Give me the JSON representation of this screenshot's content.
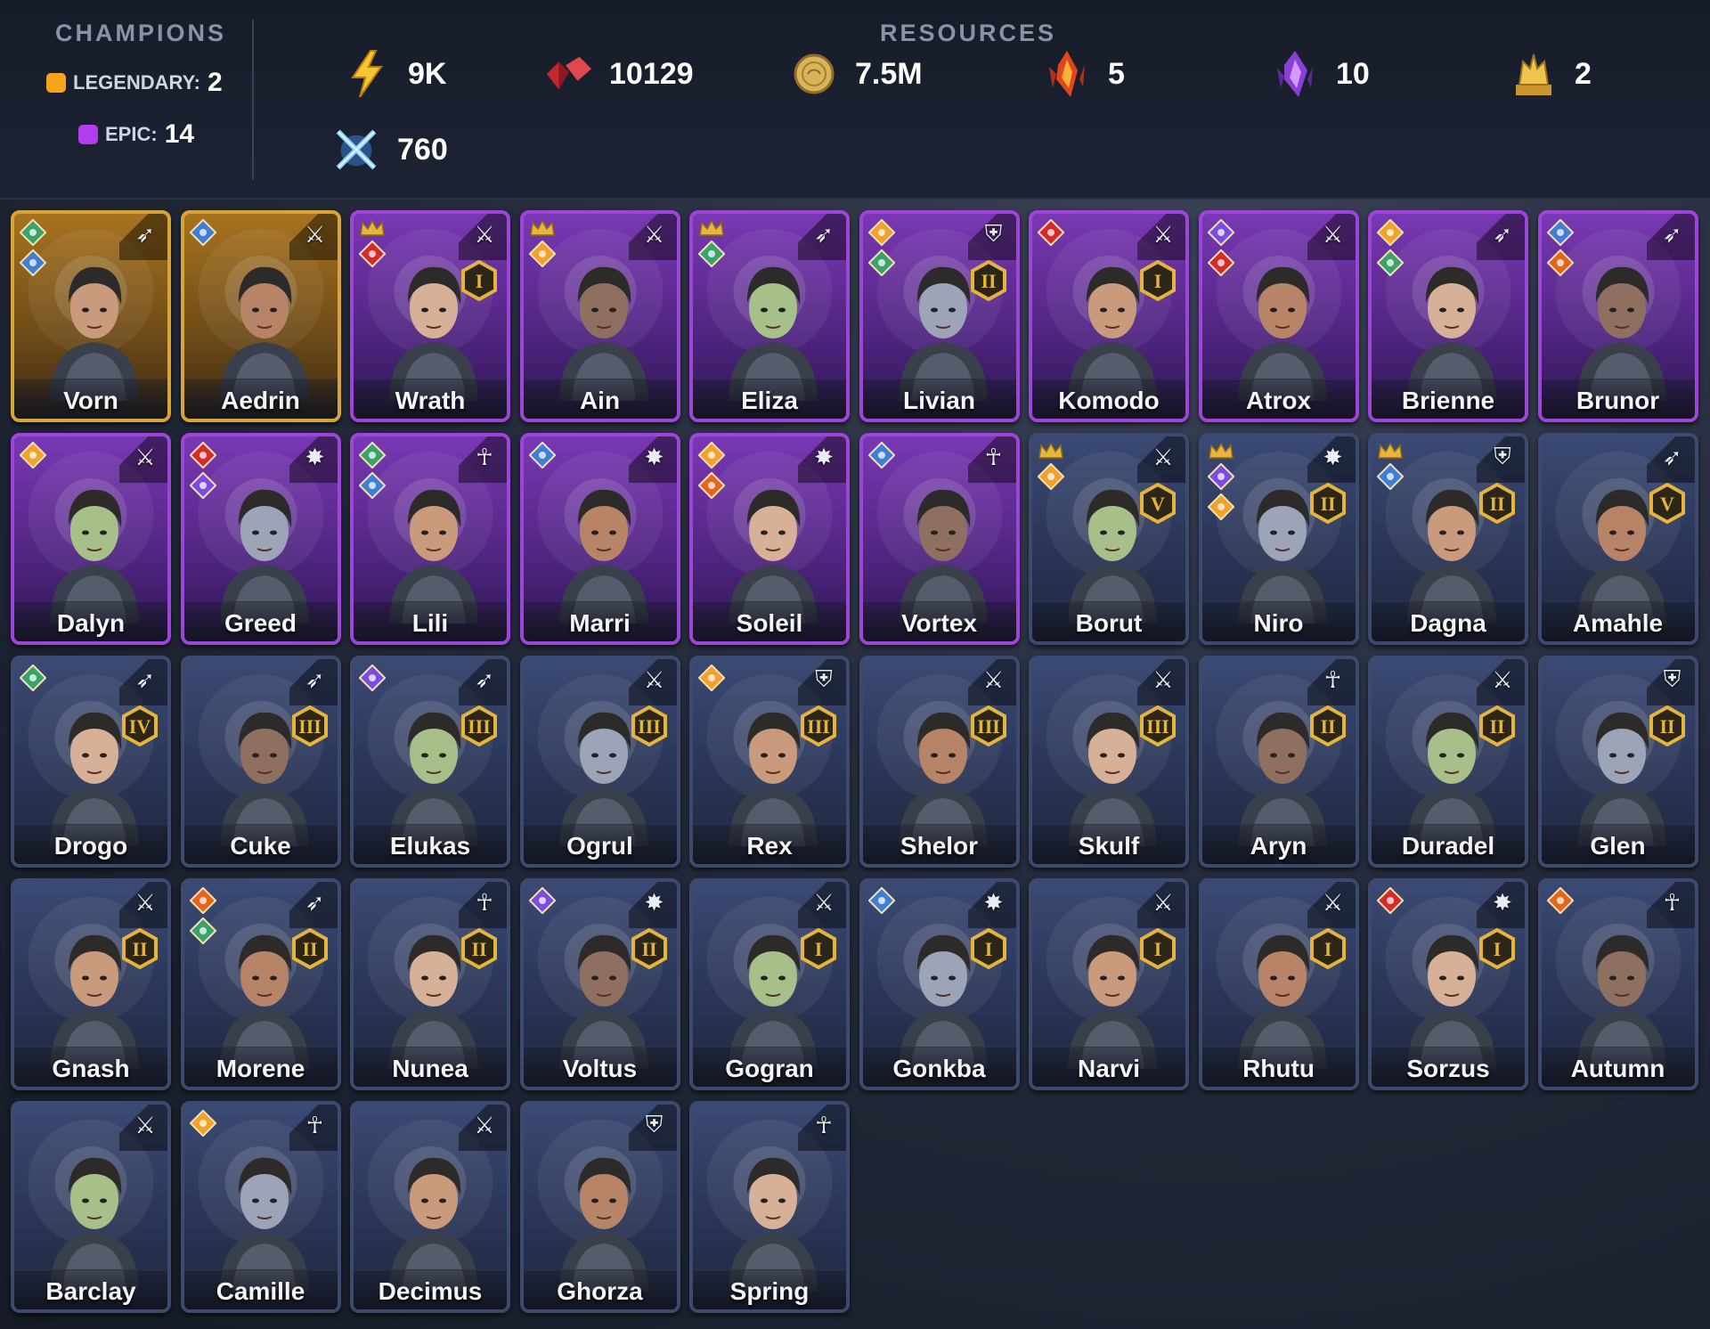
{
  "header": {
    "champions_title": "CHAMPIONS",
    "resources_title": "RESOURCES",
    "legendary": {
      "label": "LEGENDARY:",
      "count": "2",
      "color": "#f4a51c"
    },
    "epic": {
      "label": "EPIC:",
      "count": "14",
      "color": "#b23cf0"
    },
    "resources": [
      {
        "icon": "energy-icon",
        "value": "9K"
      },
      {
        "icon": "gem-icon",
        "value": "10129"
      },
      {
        "icon": "coin-icon",
        "value": "7.5M"
      },
      {
        "icon": "fire-shard-icon",
        "value": "5"
      },
      {
        "icon": "void-shard-icon",
        "value": "10"
      },
      {
        "icon": "gold-statue-icon",
        "value": "2"
      },
      {
        "icon": "crossed-swords-icon",
        "value": "760"
      }
    ]
  },
  "champions": [
    {
      "name": "Vorn",
      "rarity": "legendary",
      "role": "bow",
      "affinities": [
        "green",
        "blue"
      ],
      "crown": false,
      "rank": ""
    },
    {
      "name": "Aedrin",
      "rarity": "legendary",
      "role": "sword",
      "affinities": [
        "blue"
      ],
      "crown": false,
      "rank": ""
    },
    {
      "name": "Wrath",
      "rarity": "epic",
      "role": "sword",
      "affinities": [
        "red"
      ],
      "crown": true,
      "rank": "I"
    },
    {
      "name": "Ain",
      "rarity": "epic",
      "role": "sword",
      "affinities": [
        "orange"
      ],
      "crown": true,
      "rank": ""
    },
    {
      "name": "Eliza",
      "rarity": "epic",
      "role": "bow",
      "affinities": [
        "green"
      ],
      "crown": true,
      "rank": ""
    },
    {
      "name": "Livian",
      "rarity": "epic",
      "role": "shield",
      "affinities": [
        "orange",
        "green"
      ],
      "crown": false,
      "rank": "II"
    },
    {
      "name": "Komodo",
      "rarity": "epic",
      "role": "sword",
      "affinities": [
        "red"
      ],
      "crown": false,
      "rank": "I"
    },
    {
      "name": "Atrox",
      "rarity": "epic",
      "role": "sword",
      "affinities": [
        "purple",
        "red"
      ],
      "crown": false,
      "rank": ""
    },
    {
      "name": "Brienne",
      "rarity": "epic",
      "role": "bow",
      "affinities": [
        "orange",
        "green"
      ],
      "crown": false,
      "rank": ""
    },
    {
      "name": "Brunor",
      "rarity": "epic",
      "role": "bow",
      "affinities": [
        "blue",
        "fire"
      ],
      "crown": false,
      "rank": ""
    },
    {
      "name": "Dalyn",
      "rarity": "epic",
      "role": "sword",
      "affinities": [
        "orange"
      ],
      "crown": false,
      "rank": ""
    },
    {
      "name": "Greed",
      "rarity": "epic",
      "role": "staff",
      "affinities": [
        "red",
        "purple"
      ],
      "crown": false,
      "rank": ""
    },
    {
      "name": "Lili",
      "rarity": "epic",
      "role": "support",
      "affinities": [
        "green",
        "blue"
      ],
      "crown": false,
      "rank": ""
    },
    {
      "name": "Marri",
      "rarity": "epic",
      "role": "staff",
      "affinities": [
        "blue"
      ],
      "crown": false,
      "rank": ""
    },
    {
      "name": "Soleil",
      "rarity": "epic",
      "role": "staff",
      "affinities": [
        "orange",
        "fire"
      ],
      "crown": false,
      "rank": ""
    },
    {
      "name": "Vortex",
      "rarity": "epic",
      "role": "support",
      "affinities": [
        "blue"
      ],
      "crown": false,
      "rank": ""
    },
    {
      "name": "Borut",
      "rarity": "rare",
      "role": "sword",
      "affinities": [
        "orange"
      ],
      "crown": true,
      "rank": "V"
    },
    {
      "name": "Niro",
      "rarity": "rare",
      "role": "staff",
      "affinities": [
        "purple",
        "orange"
      ],
      "crown": true,
      "rank": "II"
    },
    {
      "name": "Dagna",
      "rarity": "rare",
      "role": "shield",
      "affinities": [
        "blue"
      ],
      "crown": true,
      "rank": "II"
    },
    {
      "name": "Amahle",
      "rarity": "rare",
      "role": "bow",
      "affinities": [],
      "crown": false,
      "rank": "V"
    },
    {
      "name": "Drogo",
      "rarity": "rare",
      "role": "bow",
      "affinities": [
        "green"
      ],
      "crown": false,
      "rank": "IV"
    },
    {
      "name": "Cuke",
      "rarity": "rare",
      "role": "bow",
      "affinities": [],
      "crown": false,
      "rank": "III"
    },
    {
      "name": "Elukas",
      "rarity": "rare",
      "role": "bow",
      "affinities": [
        "purple"
      ],
      "crown": false,
      "rank": "III"
    },
    {
      "name": "Ogrul",
      "rarity": "rare",
      "role": "sword",
      "affinities": [],
      "crown": false,
      "rank": "III"
    },
    {
      "name": "Rex",
      "rarity": "rare",
      "role": "shield",
      "affinities": [
        "orange"
      ],
      "crown": false,
      "rank": "III"
    },
    {
      "name": "Shelor",
      "rarity": "rare",
      "role": "sword",
      "affinities": [],
      "crown": false,
      "rank": "III"
    },
    {
      "name": "Skulf",
      "rarity": "rare",
      "role": "sword",
      "affinities": [],
      "crown": false,
      "rank": "III"
    },
    {
      "name": "Aryn",
      "rarity": "rare",
      "role": "support",
      "affinities": [],
      "crown": false,
      "rank": "II"
    },
    {
      "name": "Duradel",
      "rarity": "rare",
      "role": "sword",
      "affinities": [],
      "crown": false,
      "rank": "II"
    },
    {
      "name": "Glen",
      "rarity": "rare",
      "role": "shield",
      "affinities": [],
      "crown": false,
      "rank": "II"
    },
    {
      "name": "Gnash",
      "rarity": "rare",
      "role": "sword",
      "affinities": [],
      "crown": false,
      "rank": "II"
    },
    {
      "name": "Morene",
      "rarity": "rare",
      "role": "bow",
      "affinities": [
        "fire",
        "green"
      ],
      "crown": false,
      "rank": "II"
    },
    {
      "name": "Nunea",
      "rarity": "rare",
      "role": "support",
      "affinities": [],
      "crown": false,
      "rank": "II"
    },
    {
      "name": "Voltus",
      "rarity": "rare",
      "role": "staff",
      "affinities": [
        "purple"
      ],
      "crown": false,
      "rank": "II"
    },
    {
      "name": "Gogran",
      "rarity": "rare",
      "role": "sword",
      "affinities": [],
      "crown": false,
      "rank": "I"
    },
    {
      "name": "Gonkba",
      "rarity": "rare",
      "role": "staff",
      "affinities": [
        "blue"
      ],
      "crown": false,
      "rank": "I"
    },
    {
      "name": "Narvi",
      "rarity": "rare",
      "role": "sword",
      "affinities": [],
      "crown": false,
      "rank": "I"
    },
    {
      "name": "Rhutu",
      "rarity": "rare",
      "role": "sword",
      "affinities": [],
      "crown": false,
      "rank": "I"
    },
    {
      "name": "Sorzus",
      "rarity": "rare",
      "role": "staff",
      "affinities": [
        "red"
      ],
      "crown": false,
      "rank": "I"
    },
    {
      "name": "Autumn",
      "rarity": "rare",
      "role": "support",
      "affinities": [
        "fire"
      ],
      "crown": false,
      "rank": ""
    },
    {
      "name": "Barclay",
      "rarity": "rare",
      "role": "sword",
      "affinities": [],
      "crown": false,
      "rank": ""
    },
    {
      "name": "Camille",
      "rarity": "rare",
      "role": "support",
      "affinities": [
        "orange"
      ],
      "crown": false,
      "rank": ""
    },
    {
      "name": "Decimus",
      "rarity": "rare",
      "role": "sword",
      "affinities": [],
      "crown": false,
      "rank": ""
    },
    {
      "name": "Ghorza",
      "rarity": "rare",
      "role": "shield",
      "affinities": [],
      "crown": false,
      "rank": ""
    },
    {
      "name": "Spring",
      "rarity": "rare",
      "role": "support",
      "affinities": [],
      "crown": false,
      "rank": ""
    }
  ],
  "colors": {
    "affinity_green": "#3aa36b",
    "affinity_blue": "#3f7fd6",
    "affinity_red": "#d62b2b",
    "affinity_orange": "#f2a12a",
    "affinity_purple": "#7a4de0",
    "affinity_fire": "#e4651b",
    "rank_gold": "#e5b43a"
  }
}
